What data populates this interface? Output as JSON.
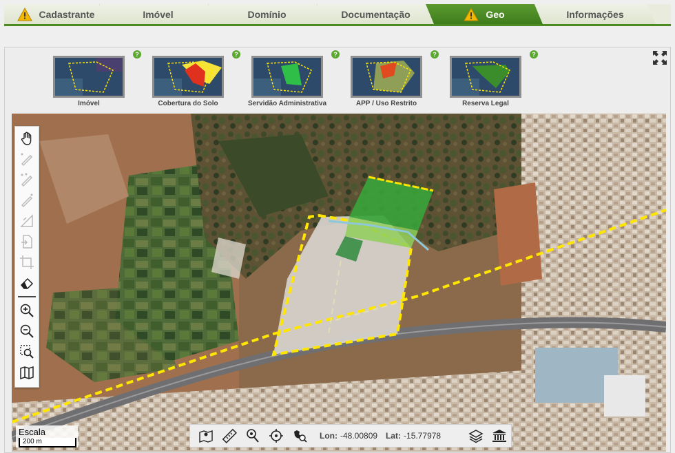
{
  "tabs": [
    {
      "label": "Cadastrante",
      "warning": true,
      "active": false
    },
    {
      "label": "Imóvel",
      "warning": false,
      "active": false
    },
    {
      "label": "Domínio",
      "warning": false,
      "active": false
    },
    {
      "label": "Documentação",
      "warning": false,
      "active": false
    },
    {
      "label": "Geo",
      "warning": true,
      "active": true
    },
    {
      "label": "Informações",
      "warning": false,
      "active": false
    }
  ],
  "layers": [
    {
      "label": "Imóvel",
      "help": "?"
    },
    {
      "label": "Cobertura do Solo",
      "help": "?"
    },
    {
      "label": "Servidão Administrativa",
      "help": "?"
    },
    {
      "label": "APP / Uso Restrito",
      "help": "?"
    },
    {
      "label": "Reserva Legal",
      "help": "?"
    }
  ],
  "map": {
    "scale_label": "Escala",
    "scale_value": "200 m",
    "lon_label": "Lon:",
    "lon_value": "-48.00809",
    "lat_label": "Lat:",
    "lat_value": "-15.77978"
  },
  "toolbar_tools": [
    {
      "name": "pan-hand-icon",
      "enabled": true
    },
    {
      "name": "draw-line-icon",
      "enabled": false
    },
    {
      "name": "draw-polygon-icon",
      "enabled": false
    },
    {
      "name": "draw-edit-icon",
      "enabled": false
    },
    {
      "name": "measure-area-icon",
      "enabled": false
    },
    {
      "name": "import-file-icon",
      "enabled": false
    },
    {
      "name": "crop-icon",
      "enabled": false
    },
    {
      "name": "eraser-icon",
      "enabled": true
    },
    {
      "name": "zoom-in-icon",
      "enabled": true
    },
    {
      "name": "zoom-out-icon",
      "enabled": true
    },
    {
      "name": "zoom-box-icon",
      "enabled": true
    },
    {
      "name": "map-icon",
      "enabled": true
    }
  ],
  "colors": {
    "accent": "#4d8a23",
    "warning": "#f2b705",
    "boundary": "#ffe600",
    "reserve": "#3aa33a",
    "app": "#8fcf5a"
  }
}
